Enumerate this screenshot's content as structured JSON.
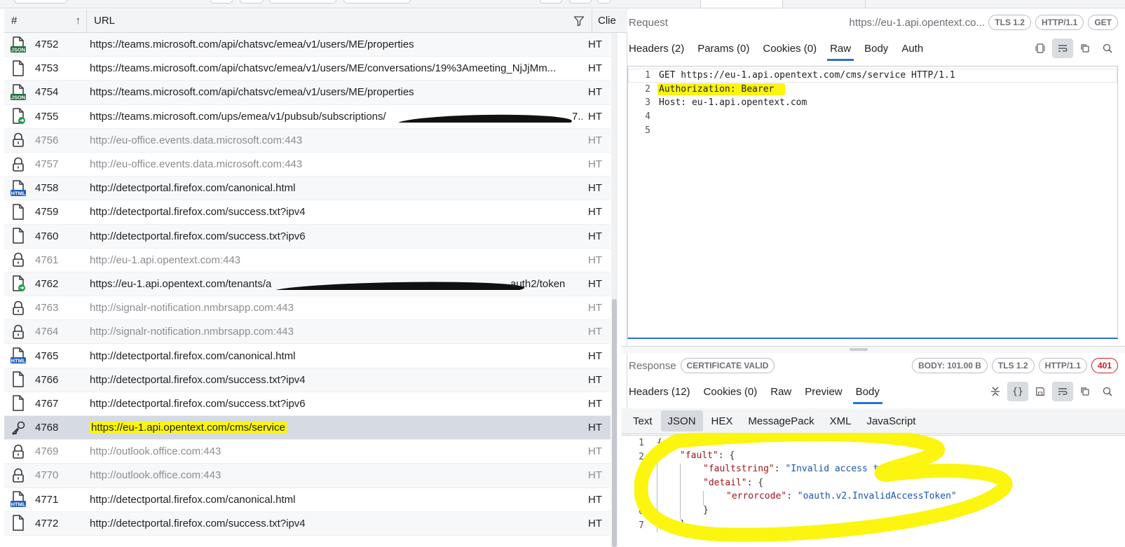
{
  "session_list": {
    "columns": {
      "num": "#",
      "url": "URL",
      "client": "Clie"
    },
    "rows": [
      {
        "id": "4752",
        "url": "https://teams.microsoft.com/api/chatsvc/emea/v1/users/ME/properties",
        "client": "HT",
        "icon": "json-file-icon",
        "dim": false
      },
      {
        "id": "4753",
        "url": "https://teams.microsoft.com/api/chatsvc/emea/v1/users/ME/conversations/19%3Ameeting_NjJjMm...",
        "client": "HT",
        "icon": "file-icon",
        "dim": false
      },
      {
        "id": "4754",
        "url": "https://teams.microsoft.com/api/chatsvc/emea/v1/users/ME/properties",
        "client": "HT",
        "icon": "json-file-icon",
        "dim": false
      },
      {
        "id": "4755",
        "url": "https://teams.microsoft.com/ups/emea/v1/pubsub/subscriptions/",
        "url_tail": "7...",
        "client": "HT",
        "icon": "file-redirect-icon",
        "dim": false
      },
      {
        "id": "4756",
        "url": "http://eu-office.events.data.microsoft.com:443",
        "client": "HT",
        "icon": "lock-icon",
        "dim": true
      },
      {
        "id": "4757",
        "url": "http://eu-office.events.data.microsoft.com:443",
        "client": "HT",
        "icon": "lock-icon",
        "dim": true
      },
      {
        "id": "4758",
        "url": "http://detectportal.firefox.com/canonical.html",
        "client": "HT",
        "icon": "html-file-icon",
        "dim": false
      },
      {
        "id": "4759",
        "url": "http://detectportal.firefox.com/success.txt?ipv4",
        "client": "HT",
        "icon": "file-icon",
        "dim": false
      },
      {
        "id": "4760",
        "url": "http://detectportal.firefox.com/success.txt?ipv6",
        "client": "HT",
        "icon": "file-icon",
        "dim": false
      },
      {
        "id": "4761",
        "url": "http://eu-1.api.opentext.com:443",
        "client": "HT",
        "icon": "lock-icon",
        "dim": true
      },
      {
        "id": "4762",
        "url": "https://eu-1.api.opentext.com/tenants/a",
        "url_tail": "auth2/token",
        "client": "HT",
        "icon": "file-redirect-icon",
        "dim": false
      },
      {
        "id": "4763",
        "url": "http://signalr-notification.nmbrsapp.com:443",
        "client": "HT",
        "icon": "lock-icon",
        "dim": true
      },
      {
        "id": "4764",
        "url": "http://signalr-notification.nmbrsapp.com:443",
        "client": "HT",
        "icon": "lock-icon",
        "dim": true
      },
      {
        "id": "4765",
        "url": "http://detectportal.firefox.com/canonical.html",
        "client": "HT",
        "icon": "html-file-icon",
        "dim": false
      },
      {
        "id": "4766",
        "url": "http://detectportal.firefox.com/success.txt?ipv4",
        "client": "HT",
        "icon": "file-icon",
        "dim": false
      },
      {
        "id": "4767",
        "url": "http://detectportal.firefox.com/success.txt?ipv6",
        "client": "HT",
        "icon": "file-icon",
        "dim": false
      },
      {
        "id": "4768",
        "url": "https://eu-1.api.opentext.com/cms/service",
        "client": "HT",
        "icon": "key-icon",
        "dim": false,
        "selected": true
      },
      {
        "id": "4769",
        "url": "http://outlook.office.com:443",
        "client": "HT",
        "icon": "lock-icon",
        "dim": true
      },
      {
        "id": "4770",
        "url": "http://outlook.office.com:443",
        "client": "HT",
        "icon": "lock-icon",
        "dim": true
      },
      {
        "id": "4771",
        "url": "http://detectportal.firefox.com/canonical.html",
        "client": "HT",
        "icon": "html-file-icon",
        "dim": false
      },
      {
        "id": "4772",
        "url": "http://detectportal.firefox.com/success.txt?ipv4",
        "client": "HT",
        "icon": "file-icon",
        "dim": false
      }
    ]
  },
  "request": {
    "title": "Request",
    "url_short": "https://eu-1.api.opentext.co...",
    "pills": [
      "TLS 1.2",
      "HTTP/1.1",
      "GET"
    ],
    "tabs": [
      "Headers (2)",
      "Params (0)",
      "Cookies (0)",
      "Raw",
      "Body",
      "Auth"
    ],
    "active_tab": "Raw",
    "lines": [
      "GET https://eu-1.api.opentext.com/cms/service HTTP/1.1",
      "Authorization: Bearer",
      "Host: eu-1.api.opentext.com",
      "",
      ""
    ]
  },
  "response": {
    "title": "Response",
    "cert_pill": "CERTIFICATE VALID",
    "pills": [
      "BODY: 101.00 B",
      "TLS 1.2",
      "HTTP/1.1"
    ],
    "status": "401",
    "tabs": [
      "Headers (12)",
      "Cookies (0)",
      "Raw",
      "Preview",
      "Body"
    ],
    "active_tab": "Body",
    "sub_tabs": [
      "Text",
      "JSON",
      "HEX",
      "MessagePack",
      "XML",
      "JavaScript"
    ],
    "active_sub_tab": "JSON",
    "json": {
      "open": "{",
      "fault_key": "\"fault\"",
      "faultstring_key": "\"faultstring\"",
      "faultstring_val": "\"Invalid access token\"",
      "detail_key": "\"detail\"",
      "errorcode_key": "\"errorcode\"",
      "errorcode_val": "\"oauth.v2.InvalidAccessToken\"",
      "close_inner": "}",
      "close_fault": "}"
    }
  },
  "colors": {
    "highlight": "#fbf50f",
    "accent": "#2b6fd6",
    "status_error": "#c21d1d",
    "selected_row": "#d5dae3"
  }
}
